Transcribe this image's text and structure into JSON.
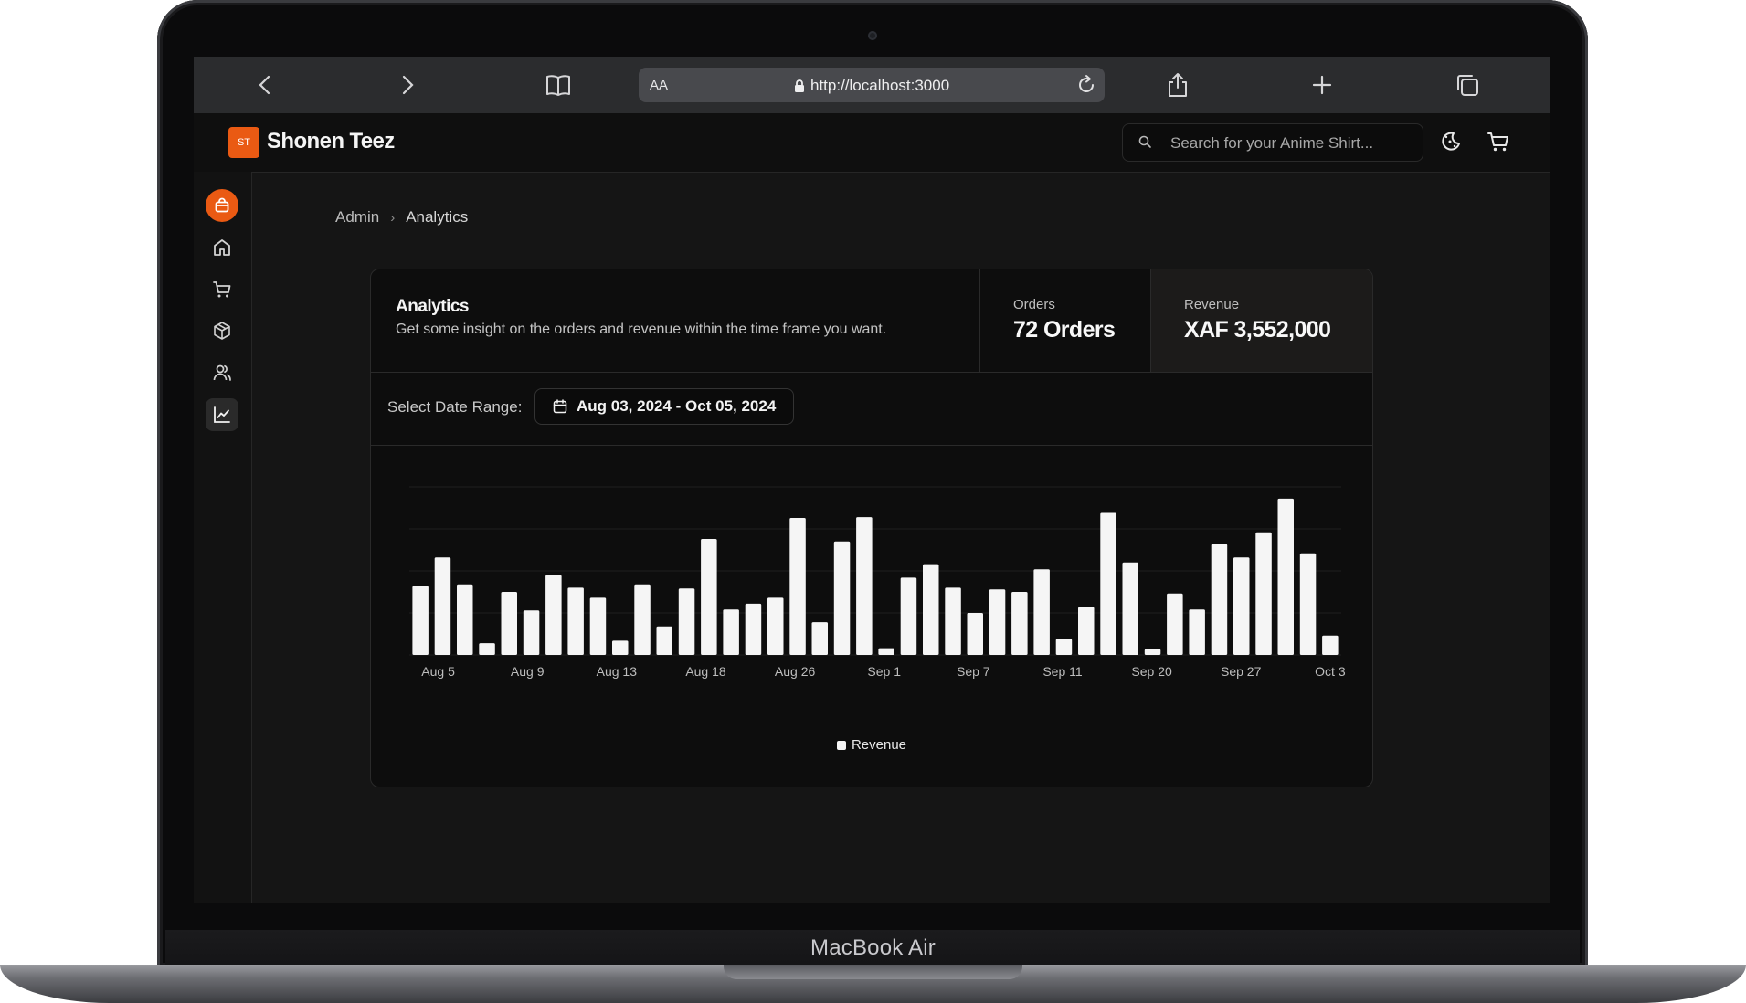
{
  "device": {
    "label": "MacBook Air"
  },
  "browser": {
    "text_size_label": "AA",
    "url": "http://localhost:3000"
  },
  "header": {
    "brand_name": "Shonen Teez",
    "logo_text": "ST",
    "search_placeholder": "Search for your Anime Shirt...",
    "accent_color": "#ea5a13"
  },
  "sidebar": {
    "items": [
      {
        "name": "store",
        "icon": "shopping-bag-icon"
      },
      {
        "name": "home",
        "icon": "home-icon"
      },
      {
        "name": "orders",
        "icon": "cart-icon"
      },
      {
        "name": "products",
        "icon": "package-icon"
      },
      {
        "name": "customers",
        "icon": "users-icon"
      },
      {
        "name": "analytics",
        "icon": "line-chart-icon",
        "active": true
      }
    ]
  },
  "breadcrumb": {
    "root": "Admin",
    "current": "Analytics"
  },
  "analytics": {
    "title": "Analytics",
    "description": "Get some insight on the orders and revenue within the time frame you want.",
    "orders_label": "Orders",
    "orders_value": "72 Orders",
    "revenue_label": "Revenue",
    "revenue_value": "XAF 3,552,000",
    "range_label": "Select Date Range:",
    "range_value": "Aug 03, 2024 - Oct 05, 2024"
  },
  "chart_data": {
    "type": "bar",
    "x_tick_labels": [
      "Aug 5",
      "Aug 9",
      "Aug 13",
      "Aug 18",
      "Aug 26",
      "Sep 1",
      "Sep 7",
      "Sep 11",
      "Sep 20",
      "Sep 27",
      "Oct 3"
    ],
    "bar_count": 42,
    "values": [
      82,
      116,
      84,
      14,
      75,
      53,
      95,
      80,
      68,
      17,
      84,
      34,
      79,
      138,
      54,
      61,
      68,
      163,
      39,
      135,
      164,
      8,
      92,
      108,
      80,
      50,
      78,
      75,
      102,
      19,
      57,
      169,
      110,
      7,
      73,
      54,
      132,
      116,
      146,
      186,
      121,
      23
    ],
    "ylim": [
      0,
      200
    ],
    "series": [
      {
        "name": "Revenue",
        "color": "#f5f5f5"
      }
    ],
    "grid": "horizontal",
    "legend_position": "bottom-center"
  }
}
